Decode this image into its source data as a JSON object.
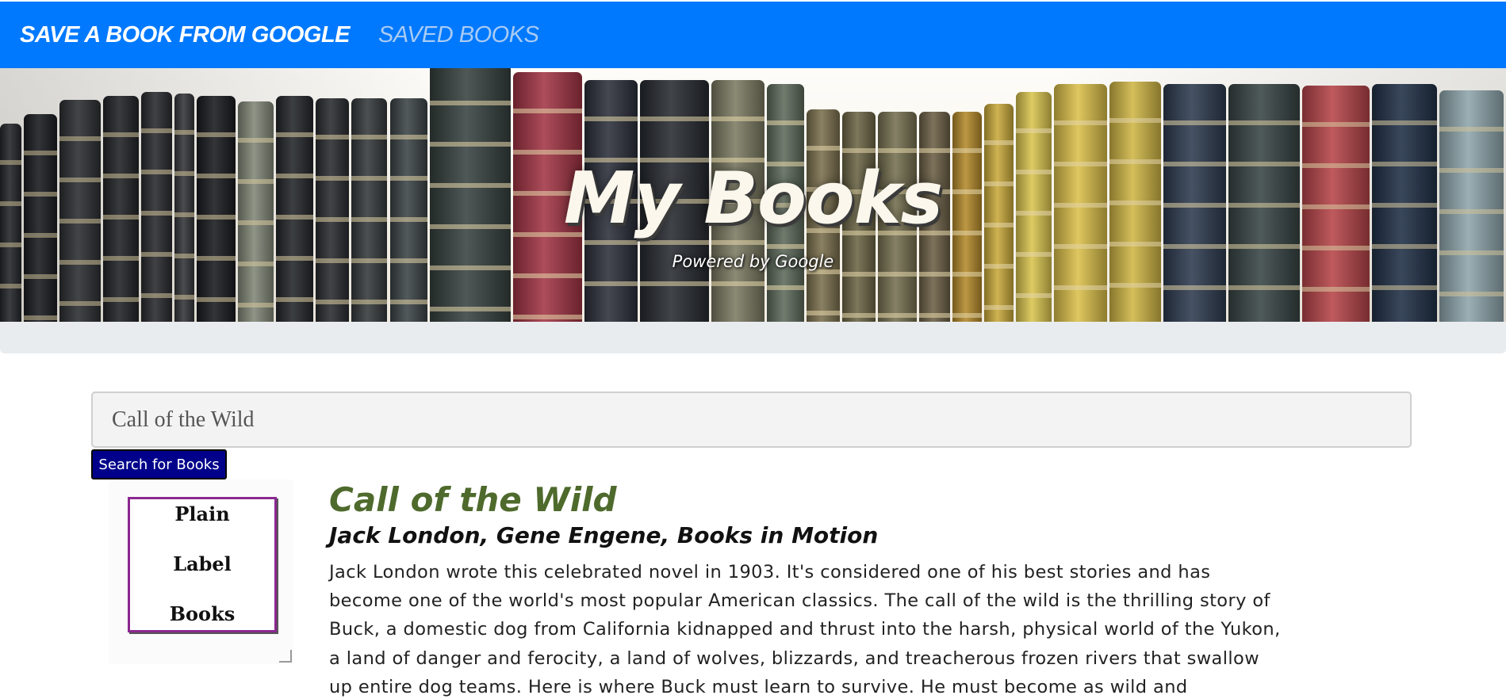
{
  "navbar": {
    "links": [
      {
        "label": "SAVE A BOOK FROM GOOGLE",
        "active": true
      },
      {
        "label": "SAVED BOOKS",
        "active": false
      }
    ]
  },
  "hero": {
    "title": "My Books",
    "subtitle": "Powered by Google"
  },
  "search": {
    "value": "Call of the Wild",
    "button_label": "Search for Books"
  },
  "results": [
    {
      "title": "Call of the Wild",
      "authors": "Jack London, Gene Engene, Books in Motion",
      "cover_words": [
        "Plain",
        "Label",
        "Books"
      ],
      "description": "Jack London wrote this celebrated novel in 1903. It's considered one of his best stories and has become one of the world's most popular American classics. The call of the wild is the thrilling story of Buck, a domestic dog from California kidnapped and thrust into the harsh, physical world of the Yukon, a land of danger and ferocity, a land of wolves, blizzards, and treacherous frozen rivers that swallow up entire dog teams. Here is where Buck must learn to survive. He must become as wild and"
    }
  ],
  "colors": {
    "navbar": "#0079ff",
    "search_button": "#00008b",
    "title": "#4e6a2c"
  }
}
